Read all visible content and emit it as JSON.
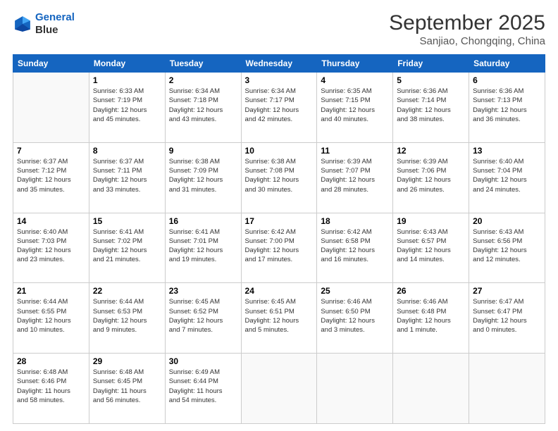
{
  "logo": {
    "line1": "General",
    "line2": "Blue"
  },
  "title": "September 2025",
  "subtitle": "Sanjiao, Chongqing, China",
  "weekdays": [
    "Sunday",
    "Monday",
    "Tuesday",
    "Wednesday",
    "Thursday",
    "Friday",
    "Saturday"
  ],
  "weeks": [
    [
      {
        "day": "",
        "info": ""
      },
      {
        "day": "1",
        "info": "Sunrise: 6:33 AM\nSunset: 7:19 PM\nDaylight: 12 hours\nand 45 minutes."
      },
      {
        "day": "2",
        "info": "Sunrise: 6:34 AM\nSunset: 7:18 PM\nDaylight: 12 hours\nand 43 minutes."
      },
      {
        "day": "3",
        "info": "Sunrise: 6:34 AM\nSunset: 7:17 PM\nDaylight: 12 hours\nand 42 minutes."
      },
      {
        "day": "4",
        "info": "Sunrise: 6:35 AM\nSunset: 7:15 PM\nDaylight: 12 hours\nand 40 minutes."
      },
      {
        "day": "5",
        "info": "Sunrise: 6:36 AM\nSunset: 7:14 PM\nDaylight: 12 hours\nand 38 minutes."
      },
      {
        "day": "6",
        "info": "Sunrise: 6:36 AM\nSunset: 7:13 PM\nDaylight: 12 hours\nand 36 minutes."
      }
    ],
    [
      {
        "day": "7",
        "info": "Sunrise: 6:37 AM\nSunset: 7:12 PM\nDaylight: 12 hours\nand 35 minutes."
      },
      {
        "day": "8",
        "info": "Sunrise: 6:37 AM\nSunset: 7:11 PM\nDaylight: 12 hours\nand 33 minutes."
      },
      {
        "day": "9",
        "info": "Sunrise: 6:38 AM\nSunset: 7:09 PM\nDaylight: 12 hours\nand 31 minutes."
      },
      {
        "day": "10",
        "info": "Sunrise: 6:38 AM\nSunset: 7:08 PM\nDaylight: 12 hours\nand 30 minutes."
      },
      {
        "day": "11",
        "info": "Sunrise: 6:39 AM\nSunset: 7:07 PM\nDaylight: 12 hours\nand 28 minutes."
      },
      {
        "day": "12",
        "info": "Sunrise: 6:39 AM\nSunset: 7:06 PM\nDaylight: 12 hours\nand 26 minutes."
      },
      {
        "day": "13",
        "info": "Sunrise: 6:40 AM\nSunset: 7:04 PM\nDaylight: 12 hours\nand 24 minutes."
      }
    ],
    [
      {
        "day": "14",
        "info": "Sunrise: 6:40 AM\nSunset: 7:03 PM\nDaylight: 12 hours\nand 23 minutes."
      },
      {
        "day": "15",
        "info": "Sunrise: 6:41 AM\nSunset: 7:02 PM\nDaylight: 12 hours\nand 21 minutes."
      },
      {
        "day": "16",
        "info": "Sunrise: 6:41 AM\nSunset: 7:01 PM\nDaylight: 12 hours\nand 19 minutes."
      },
      {
        "day": "17",
        "info": "Sunrise: 6:42 AM\nSunset: 7:00 PM\nDaylight: 12 hours\nand 17 minutes."
      },
      {
        "day": "18",
        "info": "Sunrise: 6:42 AM\nSunset: 6:58 PM\nDaylight: 12 hours\nand 16 minutes."
      },
      {
        "day": "19",
        "info": "Sunrise: 6:43 AM\nSunset: 6:57 PM\nDaylight: 12 hours\nand 14 minutes."
      },
      {
        "day": "20",
        "info": "Sunrise: 6:43 AM\nSunset: 6:56 PM\nDaylight: 12 hours\nand 12 minutes."
      }
    ],
    [
      {
        "day": "21",
        "info": "Sunrise: 6:44 AM\nSunset: 6:55 PM\nDaylight: 12 hours\nand 10 minutes."
      },
      {
        "day": "22",
        "info": "Sunrise: 6:44 AM\nSunset: 6:53 PM\nDaylight: 12 hours\nand 9 minutes."
      },
      {
        "day": "23",
        "info": "Sunrise: 6:45 AM\nSunset: 6:52 PM\nDaylight: 12 hours\nand 7 minutes."
      },
      {
        "day": "24",
        "info": "Sunrise: 6:45 AM\nSunset: 6:51 PM\nDaylight: 12 hours\nand 5 minutes."
      },
      {
        "day": "25",
        "info": "Sunrise: 6:46 AM\nSunset: 6:50 PM\nDaylight: 12 hours\nand 3 minutes."
      },
      {
        "day": "26",
        "info": "Sunrise: 6:46 AM\nSunset: 6:48 PM\nDaylight: 12 hours\nand 1 minute."
      },
      {
        "day": "27",
        "info": "Sunrise: 6:47 AM\nSunset: 6:47 PM\nDaylight: 12 hours\nand 0 minutes."
      }
    ],
    [
      {
        "day": "28",
        "info": "Sunrise: 6:48 AM\nSunset: 6:46 PM\nDaylight: 11 hours\nand 58 minutes."
      },
      {
        "day": "29",
        "info": "Sunrise: 6:48 AM\nSunset: 6:45 PM\nDaylight: 11 hours\nand 56 minutes."
      },
      {
        "day": "30",
        "info": "Sunrise: 6:49 AM\nSunset: 6:44 PM\nDaylight: 11 hours\nand 54 minutes."
      },
      {
        "day": "",
        "info": ""
      },
      {
        "day": "",
        "info": ""
      },
      {
        "day": "",
        "info": ""
      },
      {
        "day": "",
        "info": ""
      }
    ]
  ]
}
